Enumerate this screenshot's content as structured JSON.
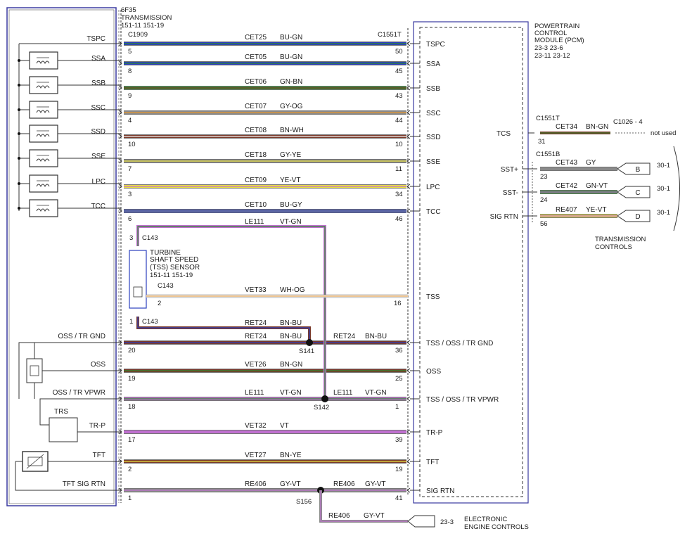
{
  "transmission": {
    "model": "6F35",
    "title": "TRANSMISSION",
    "refs": "151-11  151-19"
  },
  "pcm": {
    "line1": "POWERTRAIN",
    "line2": "CONTROL",
    "line3": "MODULE (PCM)",
    "refs1": "23-3    23-6",
    "refs2": "23-11  23-12"
  },
  "connectors": {
    "trans": "C1909",
    "pcm_t": "C1551T",
    "pcm_t2": "C1551T",
    "pcm_b": "C1551B",
    "c143": "C143",
    "c1026": "C1026 - 4",
    "s141": "S141",
    "s142": "S142",
    "s156": "S156"
  },
  "colors": {
    "BU": "#2b3fbf",
    "GN": "#2f8a2f",
    "BN": "#7a3a2a",
    "GY": "#8a8a8a",
    "OG": "#e8962e",
    "WH": "#f4f4f4",
    "YE": "#e8e040",
    "VT": "#c070d0"
  },
  "circuits": [
    {
      "left_label": "TSPC",
      "left_pin": "5",
      "circuit": "CET25",
      "color": "BU-GN",
      "right_pin": "50",
      "pcm_label": "TSPC"
    },
    {
      "left_label": "SSA",
      "left_pin": "8",
      "circuit": "CET05",
      "color": "BU-GN",
      "right_pin": "45",
      "pcm_label": "SSA"
    },
    {
      "left_label": "SSB",
      "left_pin": "9",
      "circuit": "CET06",
      "color": "GN-BN",
      "right_pin": "43",
      "pcm_label": "SSB"
    },
    {
      "left_label": "SSC",
      "left_pin": "4",
      "circuit": "CET07",
      "color": "GY-OG",
      "right_pin": "44",
      "pcm_label": "SSC"
    },
    {
      "left_label": "SSD",
      "left_pin": "10",
      "circuit": "CET08",
      "color": "BN-WH",
      "right_pin": "10",
      "pcm_label": "SSD"
    },
    {
      "left_label": "SSE",
      "left_pin": "7",
      "circuit": "CET18",
      "color": "GY-YE",
      "right_pin": "11",
      "pcm_label": "SSE"
    },
    {
      "left_label": "LPC",
      "left_pin": "3",
      "circuit": "CET09",
      "color": "YE-VT",
      "right_pin": "34",
      "pcm_label": "LPC"
    },
    {
      "left_label": "TCC",
      "left_pin": "6",
      "circuit": "CET10",
      "color": "BU-GY",
      "right_pin": "46",
      "pcm_label": "TCC"
    }
  ],
  "tss": {
    "sensor_line1": "TURBINE",
    "sensor_line2": "SHAFT SPEED",
    "sensor_line3": "(TSS) SENSOR",
    "sensor_refs": "151-11  151-19",
    "feed_circuit": "LE111",
    "feed_color": "VT-GN",
    "signal_circuit": "VET33",
    "signal_color": "WH-OG",
    "signal_pin_left": "2",
    "signal_pin_right": "16",
    "pcm_label": "TSS",
    "pin3": "3",
    "pin1": "1",
    "rtn_circuit": "RET24",
    "rtn_color": "BN-BU"
  },
  "lower": [
    {
      "key": "oss_gnd",
      "left_label": "OSS / TR GND",
      "left_pin": "20",
      "circuit": "RET24",
      "color": "BN-BU",
      "circuit2": "RET24",
      "color2": "BN-BU",
      "right_pin": "36",
      "pcm_label": "TSS / OSS / TR GND"
    },
    {
      "key": "oss",
      "left_label": "OSS",
      "left_pin": "19",
      "circuit": "VET26",
      "color": "BN-GN",
      "right_pin": "25",
      "pcm_label": "OSS"
    },
    {
      "key": "vpwr",
      "left_label": "OSS / TR VPWR",
      "left_pin": "18",
      "circuit": "LE111",
      "color": "VT-GN",
      "circuit2": "LE111",
      "color2": "VT-GN",
      "right_pin": "1",
      "pcm_label": "TSS / OSS / TR VPWR"
    },
    {
      "key": "trp",
      "left_label": "TR-P",
      "left_pin": "17",
      "circuit": "VET32",
      "color": "VT",
      "right_pin": "39",
      "pcm_label": "TR-P"
    },
    {
      "key": "tft",
      "left_label": "TFT",
      "left_pin": "2",
      "circuit": "VET27",
      "color": "BN-YE",
      "right_pin": "19",
      "pcm_label": "TFT"
    },
    {
      "key": "sigrtn",
      "left_label": "TFT SIG RTN",
      "left_pin": "1",
      "circuit": "RE406",
      "color": "GY-VT",
      "circuit2": "RE406",
      "color2": "GY-VT",
      "right_pin": "41",
      "pcm_label": "SIG RTN"
    }
  ],
  "trs_label": "TRS",
  "eec": {
    "circuit": "RE406",
    "color": "GY-VT",
    "ref": "23-3",
    "line1": "ELECTRONIC",
    "line2": "ENGINE CONTROLS"
  },
  "right": {
    "tcs_label": "TCS",
    "tcs_pin": "31",
    "tcs_circuit": "CET34",
    "tcs_color": "BN-GN",
    "not_used": "not used",
    "rows": [
      {
        "pcm_label": "SST+",
        "pin": "23",
        "circuit": "CET43",
        "color": "GY",
        "letter": "B",
        "ref": "30-1"
      },
      {
        "pcm_label": "SST-",
        "pin": "24",
        "circuit": "CET42",
        "color": "GN-VT",
        "letter": "C",
        "ref": "30-1"
      },
      {
        "pcm_label": "SIG RTN",
        "pin": "56",
        "circuit": "RE407",
        "color": "YE-VT",
        "letter": "D",
        "ref": "30-1"
      }
    ],
    "tc_line1": "TRANSMISSION",
    "tc_line2": "CONTROLS"
  }
}
